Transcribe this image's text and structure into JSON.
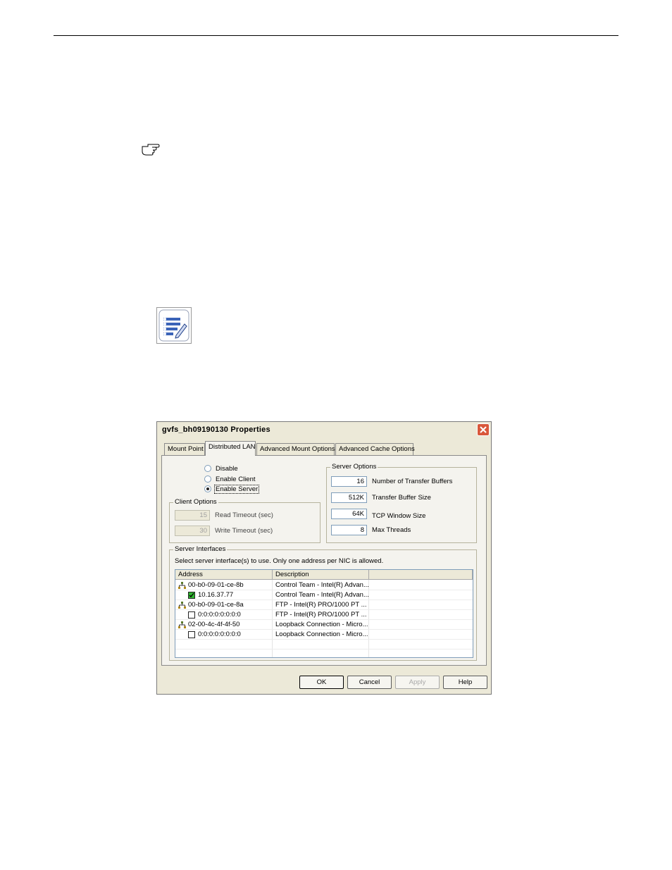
{
  "dialog": {
    "title": "gvfs_bh09190130 Properties",
    "tabs": [
      {
        "label": "Mount Point"
      },
      {
        "label": "Distributed LAN"
      },
      {
        "label": "Advanced Mount Options"
      },
      {
        "label": "Advanced Cache Options"
      }
    ],
    "mode": {
      "options": [
        "Disable",
        "Enable Client",
        "Enable Server"
      ],
      "selected": "Enable Server"
    },
    "client_options": {
      "legend": "Client Options",
      "read_timeout": {
        "value": "15",
        "label": "Read Timeout (sec)"
      },
      "write_timeout": {
        "value": "30",
        "label": "Write Timeout (sec)"
      }
    },
    "server_options": {
      "legend": "Server Options",
      "transfer_buffers": {
        "value": "16",
        "label": "Number of Transfer Buffers"
      },
      "buffer_size": {
        "value": "512K",
        "label": "Transfer Buffer Size"
      },
      "tcp_window": {
        "value": "64K",
        "label": "TCP Window Size"
      },
      "max_threads": {
        "value": "8",
        "label": "Max Threads"
      }
    },
    "server_interfaces": {
      "legend": "Server Interfaces",
      "instruction": "Select server interface(s) to use.  Only one address per NIC is allowed.",
      "columns": [
        "Address",
        "Description",
        ""
      ],
      "rows": [
        {
          "type": "nic",
          "address": "00-b0-09-01-ce-8b",
          "description": "Control Team - Intel(R) Advan..."
        },
        {
          "type": "ip",
          "checked": true,
          "address": "10.16.37.77",
          "description": "Control Team - Intel(R) Advan..."
        },
        {
          "type": "nic",
          "address": "00-b0-09-01-ce-8a",
          "description": "FTP - Intel(R) PRO/1000 PT ..."
        },
        {
          "type": "ip",
          "checked": false,
          "address": "0:0:0:0:0:0:0:0",
          "description": "FTP - Intel(R) PRO/1000 PT ..."
        },
        {
          "type": "nic",
          "address": "02-00-4c-4f-4f-50",
          "description": "Loopback Connection - Micro..."
        },
        {
          "type": "ip",
          "checked": false,
          "address": "0:0:0:0:0:0:0:0",
          "description": "Loopback Connection - Micro..."
        }
      ]
    },
    "buttons": {
      "ok": "OK",
      "cancel": "Cancel",
      "apply": "Apply",
      "help": "Help"
    }
  },
  "icons": {
    "hand": "pointing-hand-icon",
    "note": "note-list-icon",
    "close": "close-icon",
    "nic": "network-icon"
  },
  "colors": {
    "close_button": "#d9573b",
    "dialog_face": "#ece9d8",
    "checked": "#2fb52f"
  }
}
